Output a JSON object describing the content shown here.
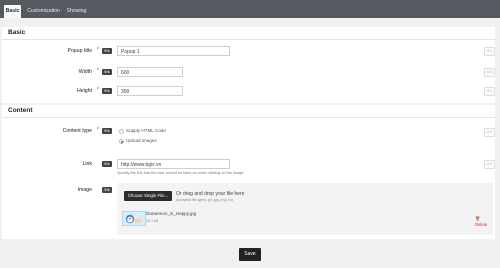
{
  "tabs": [
    {
      "label": "Basic"
    },
    {
      "label": "Customization"
    },
    {
      "label": "Showing"
    }
  ],
  "sections": {
    "basic": {
      "title": "Basic"
    },
    "content": {
      "title": "Content"
    }
  },
  "fields": {
    "popup_title": {
      "label": "Popup title",
      "code": "0 k",
      "value": "Popup 1"
    },
    "width": {
      "label": "Width",
      "code": "0 k",
      "value": "600"
    },
    "height": {
      "label": "Height",
      "code": "0 k",
      "value": "300"
    },
    "content_type": {
      "label": "Content type",
      "code": "0 k",
      "options": [
        {
          "label": "Supply HTML Code",
          "selected": false
        },
        {
          "label": "Upload images",
          "selected": true
        }
      ]
    },
    "link": {
      "label": "Link",
      "code": "0 k",
      "value": "http://www.bgix.vn",
      "help": "Specify the link that the user should be taken to when clicking on the image"
    },
    "image": {
      "label": "Image",
      "code": "0 k",
      "choose_label": "Choose Single File...",
      "drop_text": "Or drag and drop your file here",
      "drop_sub": "Accepted file types: jpl, jpg, png, ico",
      "file_name": "Doraemon_is_Happy.jpg",
      "file_size": "20.1 kB",
      "delete_label": "Delete"
    }
  },
  "reset_label": "0 k",
  "save_label": "Save",
  "colors": {
    "topbar": "#555a60",
    "danger": "#c9302c",
    "button": "#222222"
  }
}
